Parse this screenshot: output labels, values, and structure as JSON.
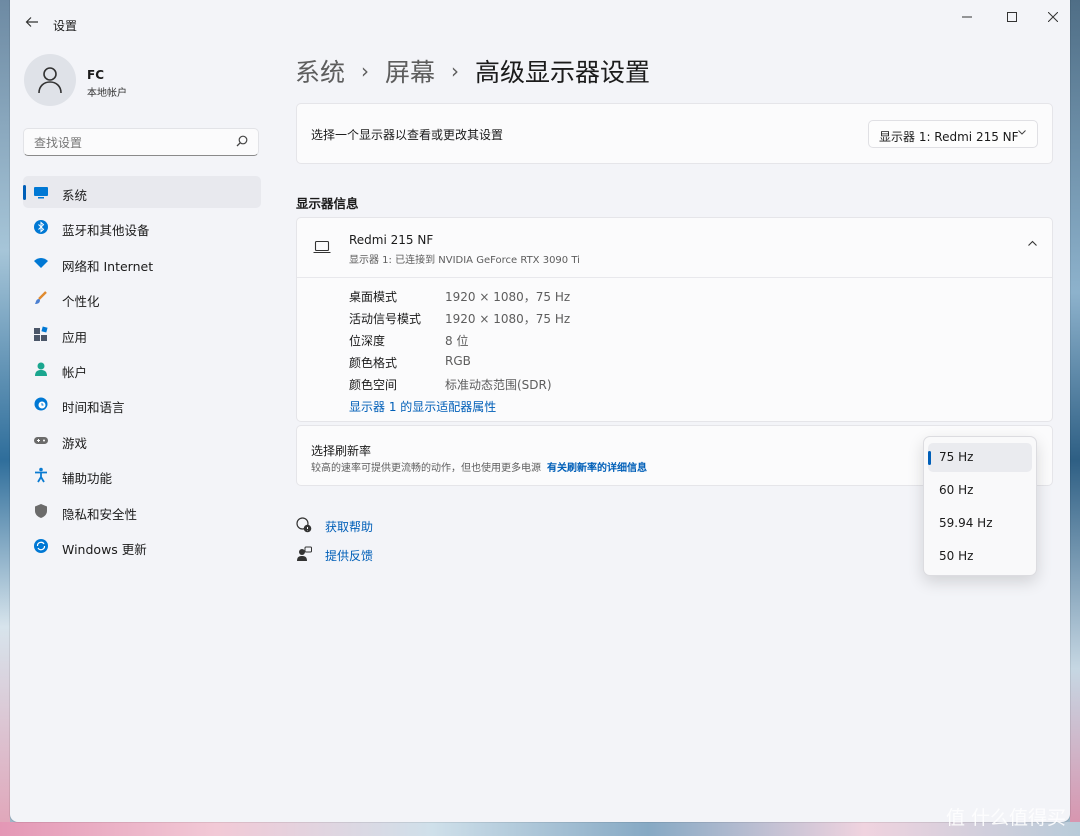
{
  "window": {
    "title": "设置"
  },
  "user": {
    "name": "FC",
    "account_type": "本地帐户"
  },
  "search": {
    "placeholder": "查找设置"
  },
  "sidebar": {
    "items": [
      {
        "label": "系统",
        "icon": "monitor-icon",
        "color": "#0078d4"
      },
      {
        "label": "蓝牙和其他设备",
        "icon": "bluetooth-icon",
        "color": "#0078d4"
      },
      {
        "label": "网络和 Internet",
        "icon": "wifi-icon",
        "color": "#0078d4"
      },
      {
        "label": "个性化",
        "icon": "brush-icon",
        "color": "#e08a2e"
      },
      {
        "label": "应用",
        "icon": "apps-icon",
        "color": "#4a5568"
      },
      {
        "label": "帐户",
        "icon": "person-icon",
        "color": "#1aa68f"
      },
      {
        "label": "时间和语言",
        "icon": "globe-clock-icon",
        "color": "#0078d4"
      },
      {
        "label": "游戏",
        "icon": "gamepad-icon",
        "color": "#6b6b6b"
      },
      {
        "label": "辅助功能",
        "icon": "accessibility-icon",
        "color": "#0a7bd1"
      },
      {
        "label": "隐私和安全性",
        "icon": "shield-icon",
        "color": "#6b6b6b"
      },
      {
        "label": "Windows 更新",
        "icon": "update-icon",
        "color": "#0078d4"
      }
    ],
    "active_index": 0
  },
  "breadcrumb": {
    "level1": "系统",
    "level2": "屏幕",
    "current": "高级显示器设置",
    "separator": "›"
  },
  "display_picker": {
    "label": "选择一个显示器以查看或更改其设置",
    "selected": "显示器 1: Redmi 215 NF"
  },
  "display_info": {
    "section_title": "显示器信息",
    "monitor_name": "Redmi 215 NF",
    "monitor_sub": "显示器 1: 已连接到 NVIDIA GeForce RTX 3090 Ti",
    "rows": [
      {
        "key": "桌面模式",
        "value": "1920 × 1080，75 Hz"
      },
      {
        "key": "活动信号模式",
        "value": "1920 × 1080，75 Hz"
      },
      {
        "key": "位深度",
        "value": "8 位"
      },
      {
        "key": "颜色格式",
        "value": "RGB"
      },
      {
        "key": "颜色空间",
        "value": "标准动态范围(SDR)"
      }
    ],
    "adapter_link": "显示器 1 的显示适配器属性"
  },
  "refresh": {
    "label": "选择刷新率",
    "description": "较高的速率可提供更流畅的动作，但也使用更多电源",
    "link": "有关刷新率的详细信息",
    "options": [
      "75 Hz",
      "60 Hz",
      "59.94 Hz",
      "50 Hz"
    ],
    "selected_index": 0
  },
  "help": {
    "get_help": "获取帮助",
    "feedback": "提供反馈"
  },
  "watermark": "值 什么值得买",
  "accent_color": "#005fb8"
}
